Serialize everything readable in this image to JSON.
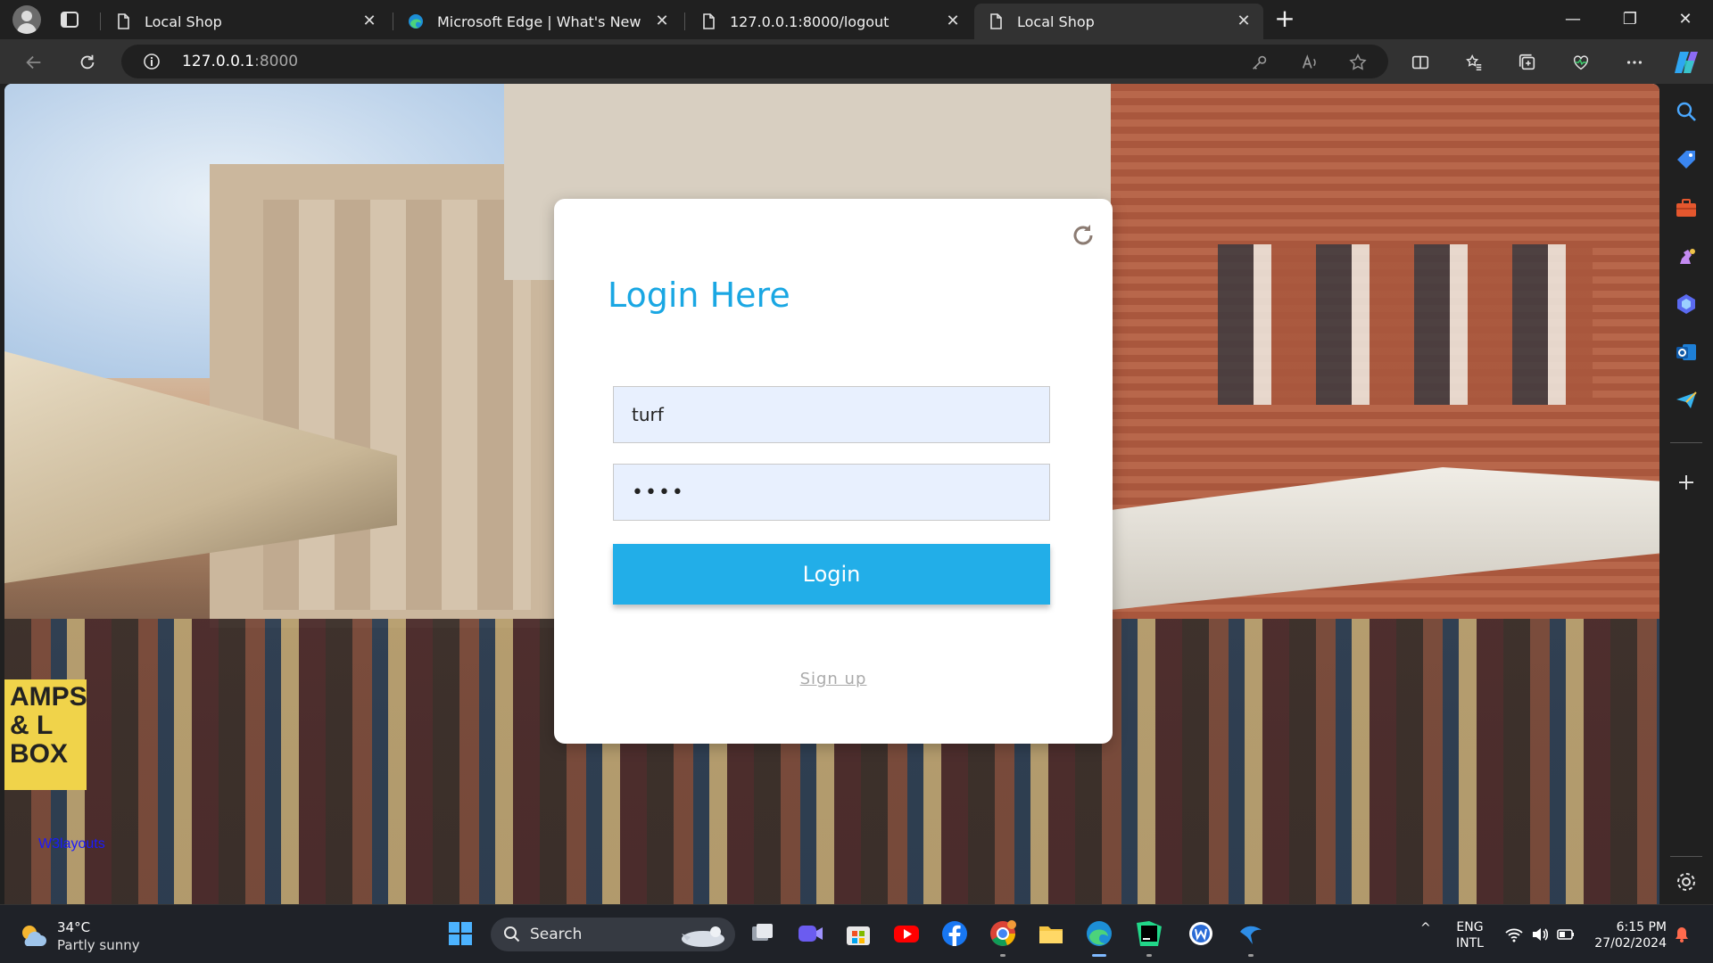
{
  "browser": {
    "tabs": [
      {
        "title": "Local Shop",
        "active": false
      },
      {
        "title": "Microsoft Edge | What's New",
        "active": false
      },
      {
        "title": "127.0.0.1:8000/logout",
        "active": false
      },
      {
        "title": "Local Shop",
        "active": true
      }
    ],
    "close_glyph": "✕",
    "new_tab_glyph": "+",
    "window_controls": {
      "minimize": "—",
      "maximize": "❐",
      "close": "✕"
    },
    "address": {
      "host": "127.0.0.1",
      "port": ":8000"
    }
  },
  "page": {
    "login_title": "Login Here",
    "username_value": "turf",
    "password_value": "••••",
    "login_button": "Login",
    "signup_link": "Sign up",
    "background_sign": "AMPS & L BOX",
    "watermark": "W3layouts",
    "colors": {
      "accent": "#22aee8",
      "title": "#1aa7e3"
    }
  },
  "sidebar": {
    "icons": [
      "search-icon",
      "tag-icon",
      "briefcase-icon",
      "chess-icon",
      "copilot-hex-icon",
      "outlook-icon",
      "send-icon",
      "add-icon",
      "settings-icon"
    ]
  },
  "taskbar": {
    "weather": {
      "temp": "34°C",
      "condition": "Partly sunny"
    },
    "search_label": "Search",
    "language": {
      "line1": "ENG",
      "line2": "INTL"
    },
    "clock": {
      "time": "6:15 PM",
      "date": "27/02/2024"
    },
    "tray_up_glyph": "^"
  }
}
